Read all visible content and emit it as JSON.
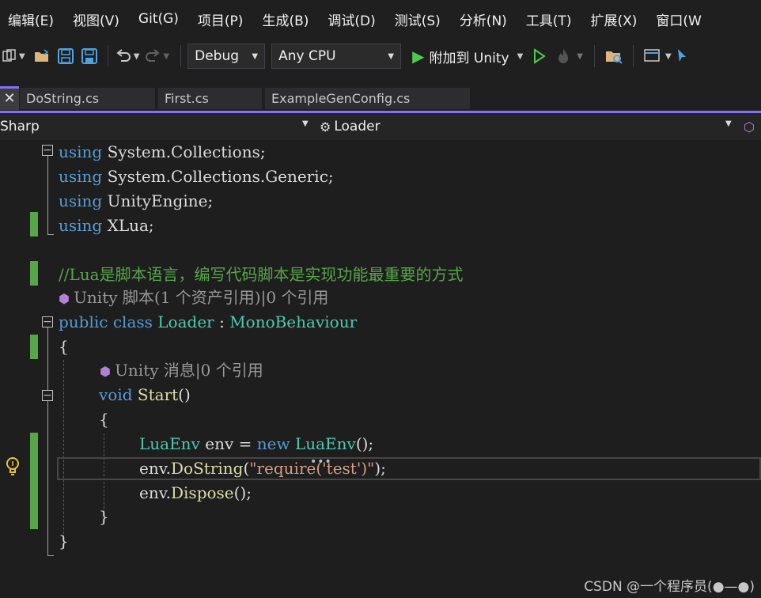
{
  "menubar": {
    "items": [
      "编辑(E)",
      "视图(V)",
      "Git(G)",
      "项目(P)",
      "生成(B)",
      "调试(D)",
      "测试(S)",
      "分析(N)",
      "工具(T)",
      "扩展(X)",
      "窗口(W"
    ]
  },
  "toolbar": {
    "configuration": "Debug",
    "platform": "Any CPU",
    "attach_label": "附加到 Unity",
    "icons": [
      "new-project-icon",
      "open-folder-icon",
      "save-icon",
      "save-all-icon",
      "undo-icon",
      "redo-icon",
      "play-icon",
      "start-without-debug-icon",
      "hot-reload-icon",
      "browse-icon",
      "layout-icon",
      "pointer-icon"
    ]
  },
  "tabs": [
    {
      "label": "DoString.cs"
    },
    {
      "label": "First.cs"
    },
    {
      "label": "ExampleGenConfig.cs"
    }
  ],
  "navbar": {
    "project": "Sharp",
    "type": "Loader"
  },
  "code": {
    "line1_kw": "using",
    "line1_rest": " System.Collections;",
    "line2_kw": "using",
    "line2_rest": " System.Collections.Generic;",
    "line3_kw": "using",
    "line3_rest": " UnityEngine;",
    "line4_kw": "using",
    "line4_rest": " XLua;",
    "comment": "//Lua是脚本语言，编写代码脚本是实现功能最重要的方式",
    "codelens_class": "Unity 脚本(1 个资产引用)|0 个引用",
    "class_public": "public",
    "class_class": "class",
    "class_name": "Loader",
    "class_colon": " : ",
    "class_base": "MonoBehaviour",
    "open_brace": "{",
    "codelens_method": "Unity 消息|0 个引用",
    "method_void": "void",
    "method_name": "Start",
    "method_parens": "()",
    "method_open": "{",
    "s1_type": "LuaEnv",
    "s1_var": " env = ",
    "s1_new": "new",
    "s1_ctor": "LuaEnv",
    "s1_end": "();",
    "s2_obj": "env.",
    "s2_fn": "DoString",
    "s2_open": "(",
    "s2_str": "\"require('test')\"",
    "s2_end": ");",
    "s3_obj": "env.",
    "s3_fn": "Dispose",
    "s3_end": "();",
    "method_close": "}",
    "close_brace": "}"
  },
  "watermark": "CSDN @一个程序员(●—●)",
  "colors": {
    "background": "#1e1e1e",
    "keyword": "#569cd6",
    "type": "#4ec9b0",
    "method": "#dcdcaa",
    "string": "#d69d85",
    "comment": "#57a64a",
    "accent": "#8470ff",
    "change_bar": "#57a64a"
  }
}
